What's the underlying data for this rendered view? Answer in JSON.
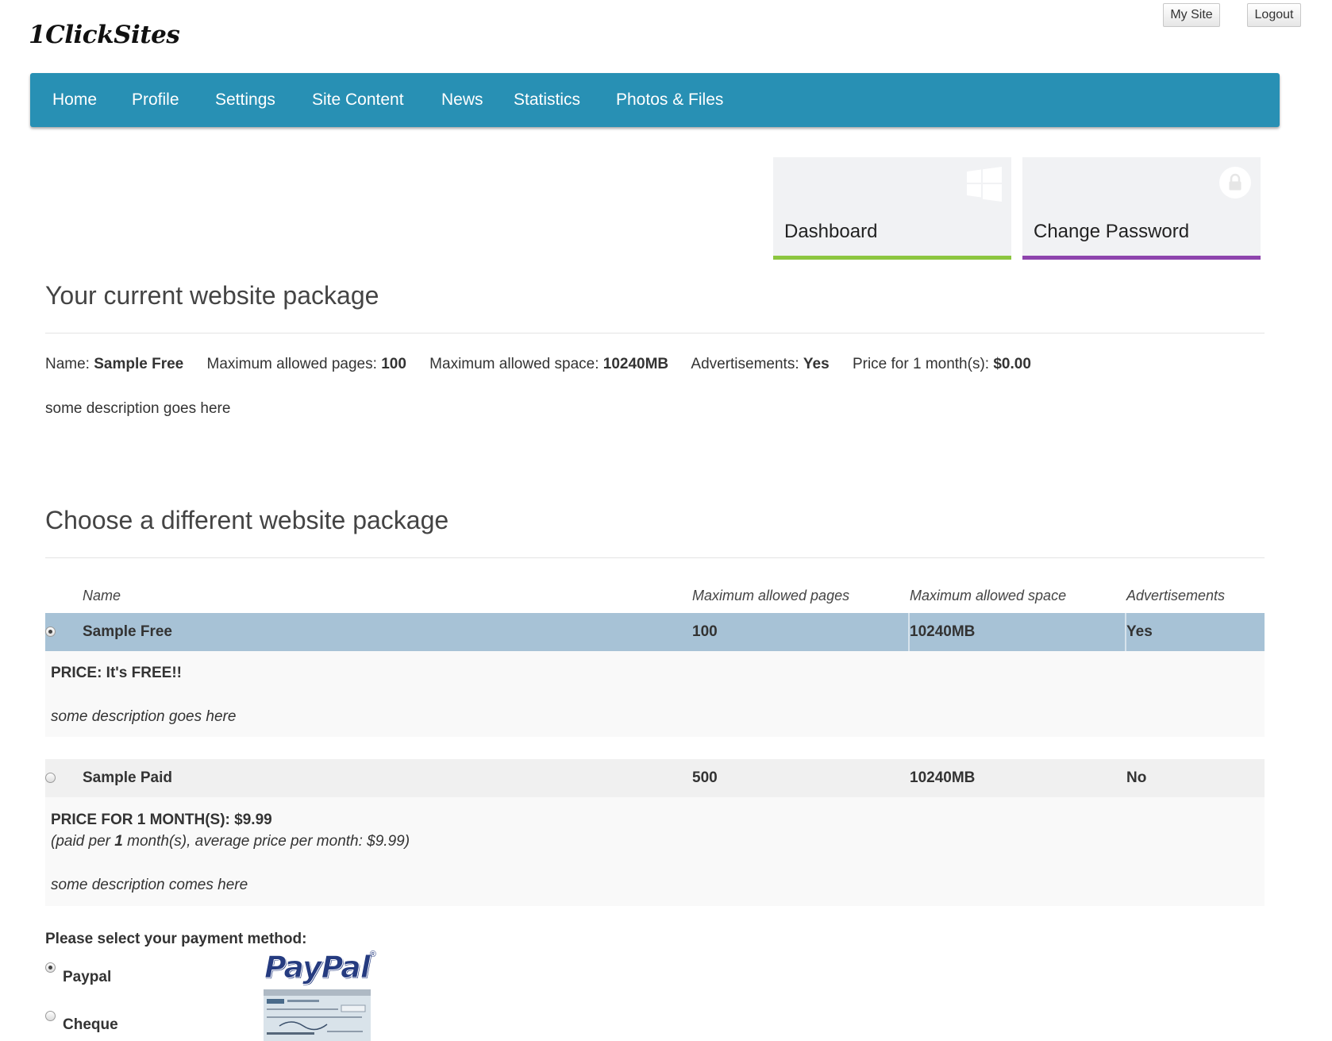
{
  "header": {
    "logo": "1ClickSites",
    "my_site": "My Site",
    "logout": "Logout"
  },
  "nav": {
    "items": [
      {
        "label": "Home"
      },
      {
        "label": "Profile"
      },
      {
        "label": "Settings"
      },
      {
        "label": "Site Content"
      },
      {
        "label": "News"
      },
      {
        "label": "Statistics"
      },
      {
        "label": "Photos & Files"
      }
    ]
  },
  "tiles": {
    "dashboard": {
      "label": "Dashboard",
      "icon": "windows-icon",
      "accent": "#8cc63f"
    },
    "change_password": {
      "label": "Change Password",
      "icon": "lock-icon",
      "accent": "#8e44ad"
    }
  },
  "current": {
    "title": "Your current website package",
    "name_label": "Name:",
    "name_value": "Sample Free",
    "pages_label": "Maximum allowed pages:",
    "pages_value": "100",
    "space_label": "Maximum allowed space:",
    "space_value": "10240MB",
    "ads_label": "Advertisements:",
    "ads_value": "Yes",
    "price_label": "Price for 1 month(s):",
    "price_value": "$0.00",
    "description": "some description goes here"
  },
  "choose": {
    "title": "Choose a different website package",
    "columns": {
      "name": "Name",
      "pages": "Maximum allowed pages",
      "space": "Maximum allowed space",
      "ads": "Advertisements"
    },
    "packages": [
      {
        "name": "Sample Free",
        "pages": "100",
        "space": "10240MB",
        "ads": "Yes",
        "selected": true,
        "price_line": "PRICE: It's FREE!!",
        "description": "some description goes here"
      },
      {
        "name": "Sample Paid",
        "pages": "500",
        "space": "10240MB",
        "ads": "No",
        "selected": false,
        "price_line": "PRICE FOR 1 MONTH(S): $9.99",
        "note_prefix": "(paid per ",
        "note_bold": "1",
        "note_suffix": " month(s), average price per month: $9.99)",
        "description": "some description comes here"
      }
    ]
  },
  "payment": {
    "prompt": "Please select your payment method:",
    "methods": [
      {
        "label": "Paypal",
        "selected": true,
        "logo_text": "PayPal"
      },
      {
        "label": "Cheque",
        "selected": false
      }
    ]
  },
  "colors": {
    "nav_bg": "#2890b4",
    "selected_row": "#a7c2d6",
    "unselected_row": "#f0f0f0",
    "paypal_dark": "#253b80",
    "paypal_light": "#179bd7"
  }
}
